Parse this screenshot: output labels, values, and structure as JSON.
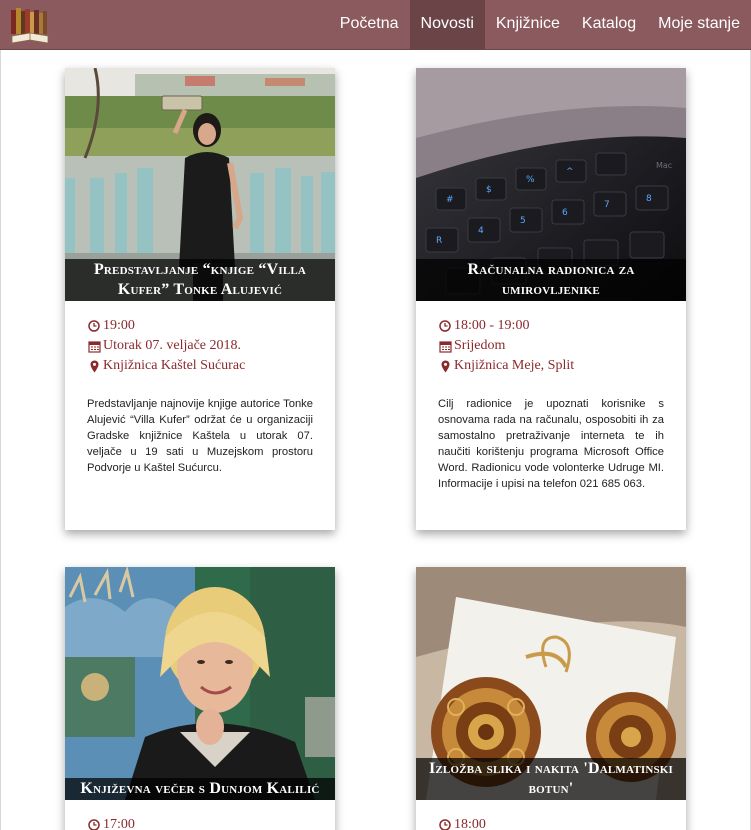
{
  "nav": {
    "items": [
      {
        "label": "Početna",
        "active": false
      },
      {
        "label": "Novosti",
        "active": true
      },
      {
        "label": "Knjižnice",
        "active": false
      },
      {
        "label": "Katalog",
        "active": false
      },
      {
        "label": "Moje stanje",
        "active": false
      }
    ]
  },
  "colors": {
    "navbar": "#8b5a5e",
    "nav_active": "#6b4448",
    "meta_text": "#8b2a2d"
  },
  "icons": {
    "logo": "books-logo-icon",
    "time": "clock-icon",
    "date": "calendar-icon",
    "location": "map-marker-icon"
  },
  "events": [
    {
      "title": "Predstavljanje “knjige “Villa Kufer” Tonke Alujević",
      "time": "19:00",
      "date": "Utorak 07. veljače 2018.",
      "location": "Knjižnica Kaštel Sućurac",
      "description": "Predstavljanje najnovije knjige autorice Tonke Alujević “Villa Kufer” održat će u organizaciji Gradske knjižnice Kaštela u utorak 07. veljače u 19 sati u Muzejskom prostoru Podvorje u Kaštel Sućurcu."
    },
    {
      "title": "Računalna radionica za umirovljenike",
      "time": "18:00 - 19:00",
      "date": "Srijedom",
      "location": "Knjižnica Meje, Split",
      "description": "Cilj radionice je upoznati korisnike s osnovama rada na računalu, osposobiti ih za samostalno pretraživanje interneta te ih naučiti korištenju programa Microsoft Office Word. Radionicu vode volonterke Udruge MI. Informacije i upisi na telefon 021 685 063."
    },
    {
      "title": "Književna večer s Dunjom Kalilić",
      "time": "17:00"
    },
    {
      "title": "Izložba slika i nakita 'Dalmatinski botun'",
      "time": "18:00"
    }
  ]
}
